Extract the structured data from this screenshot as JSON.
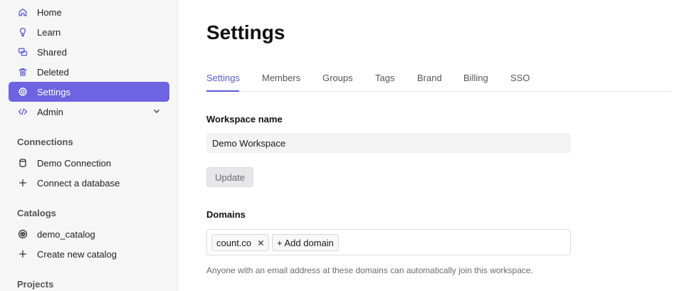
{
  "sidebar": {
    "items": [
      {
        "label": "Home",
        "icon": "home-icon"
      },
      {
        "label": "Learn",
        "icon": "lightbulb-icon"
      },
      {
        "label": "Shared",
        "icon": "shared-icon"
      },
      {
        "label": "Deleted",
        "icon": "trash-icon"
      },
      {
        "label": "Settings",
        "icon": "gear-icon",
        "active": true
      },
      {
        "label": "Admin",
        "icon": "code-icon"
      }
    ],
    "connections_title": "Connections",
    "connections": [
      {
        "label": "Demo Connection",
        "icon": "database-icon"
      },
      {
        "label": "Connect a database",
        "icon": "plus-icon"
      }
    ],
    "catalogs_title": "Catalogs",
    "catalogs": [
      {
        "label": "demo_catalog",
        "icon": "cube-icon"
      },
      {
        "label": "Create new catalog",
        "icon": "plus-icon"
      }
    ],
    "projects_title": "Projects"
  },
  "main": {
    "title": "Settings",
    "tabs": [
      {
        "label": "Settings",
        "active": true
      },
      {
        "label": "Members"
      },
      {
        "label": "Groups"
      },
      {
        "label": "Tags"
      },
      {
        "label": "Brand"
      },
      {
        "label": "Billing"
      },
      {
        "label": "SSO"
      }
    ],
    "workspace_label": "Workspace name",
    "workspace_value": "Demo Workspace",
    "update_label": "Update",
    "domains_label": "Domains",
    "domains": [
      "count.co"
    ],
    "add_domain_label": "+ Add domain",
    "help_text": "Anyone with an email address at these domains can automatically join this workspace."
  },
  "colors": {
    "accent": "#6e63e0",
    "sidebar_bg": "#f6f6f7"
  }
}
